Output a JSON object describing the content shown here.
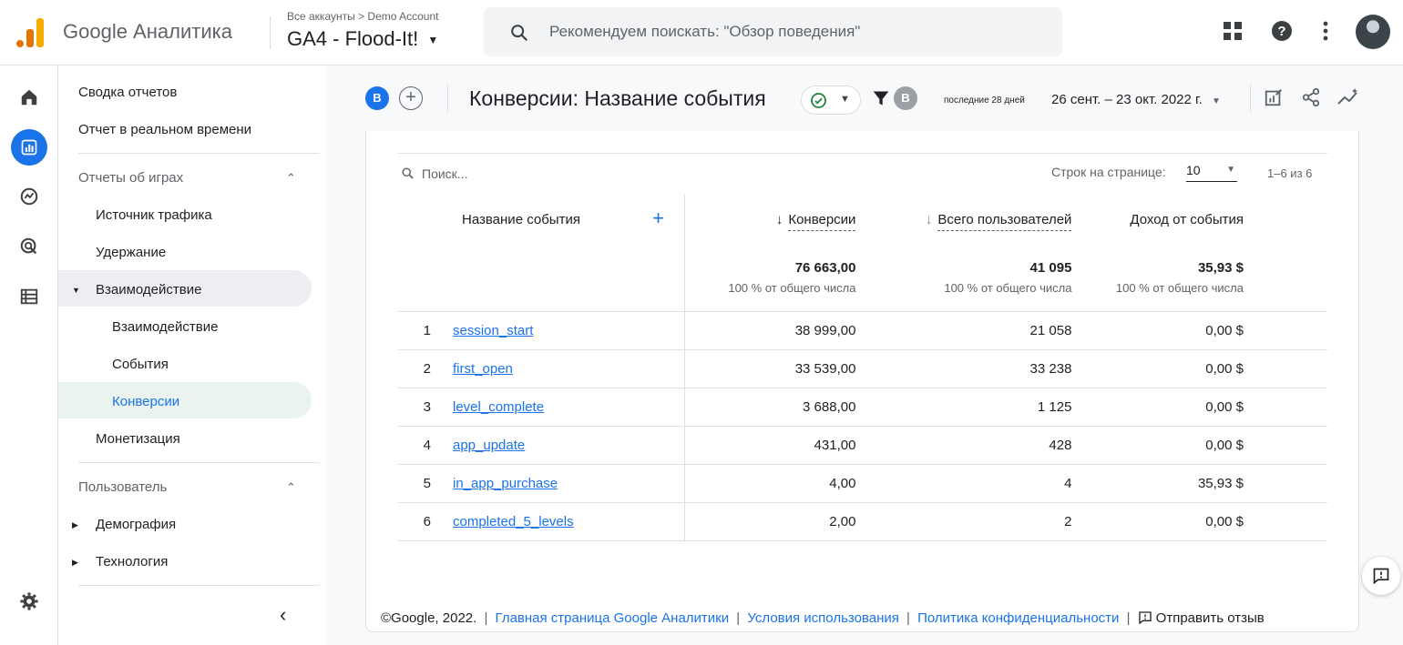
{
  "header": {
    "brand": "Google Аналитика",
    "breadcrumb": "Все аккаунты > Demo Account",
    "property": "GA4 - Flood-It!",
    "search_placeholder": "Рекомендуем поискать: \"Обзор поведения\""
  },
  "nav": {
    "items": {
      "summary": "Сводка отчетов",
      "realtime": "Отчет в реальном времени",
      "games_section": "Отчеты об играх",
      "traffic": "Источник трафика",
      "retention": "Удержание",
      "engagement": "Взаимодействие",
      "engagement_sub": "Взаимодействие",
      "events": "События",
      "conversions": "Конверсии",
      "monetization": "Монетизация",
      "user_section": "Пользователь",
      "demographics": "Демография",
      "technology": "Технология"
    }
  },
  "toolbar": {
    "segment_badge": "B",
    "add_label": "+",
    "title": "Конверсии: Название события",
    "filter_badge": "B",
    "date_label": "последние 28 дней",
    "date_range": "26 сент. – 23 окт. 2022 г."
  },
  "table": {
    "search_placeholder": "Поиск...",
    "rows_per_page_label": "Строк на странице:",
    "rows_per_page_value": "10",
    "pager": "1–6 из 6",
    "headers": {
      "event_name": "Название события",
      "conversions": "Конверсии",
      "total_users": "Всего пользователей",
      "event_revenue": "Доход от события"
    },
    "totals": {
      "conversions": "76 663,00",
      "total_users": "41 095",
      "event_revenue": "35,93 $",
      "pct": "100 % от общего числа"
    },
    "rows": [
      {
        "idx": "1",
        "name": "session_start",
        "conversions": "38 999,00",
        "users": "21 058",
        "revenue": "0,00 $"
      },
      {
        "idx": "2",
        "name": "first_open",
        "conversions": "33 539,00",
        "users": "33 238",
        "revenue": "0,00 $"
      },
      {
        "idx": "3",
        "name": "level_complete",
        "conversions": "3 688,00",
        "users": "1 125",
        "revenue": "0,00 $"
      },
      {
        "idx": "4",
        "name": "app_update",
        "conversions": "431,00",
        "users": "428",
        "revenue": "0,00 $"
      },
      {
        "idx": "5",
        "name": "in_app_purchase",
        "conversions": "4,00",
        "users": "4",
        "revenue": "35,93 $"
      },
      {
        "idx": "6",
        "name": "completed_5_levels",
        "conversions": "2,00",
        "users": "2",
        "revenue": "0,00 $"
      }
    ]
  },
  "footer": {
    "copyright": "©Google, 2022.",
    "home_link": "Главная страница Google Аналитики",
    "terms_link": "Условия использования",
    "privacy_link": "Политика конфиденциальности",
    "feedback": "Отправить отзыв"
  },
  "colors": {
    "accent": "#1a73e8",
    "nav_selected": "#eaf3ee",
    "logo_orange": "#e37400",
    "logo_yellow": "#f9ab00"
  }
}
